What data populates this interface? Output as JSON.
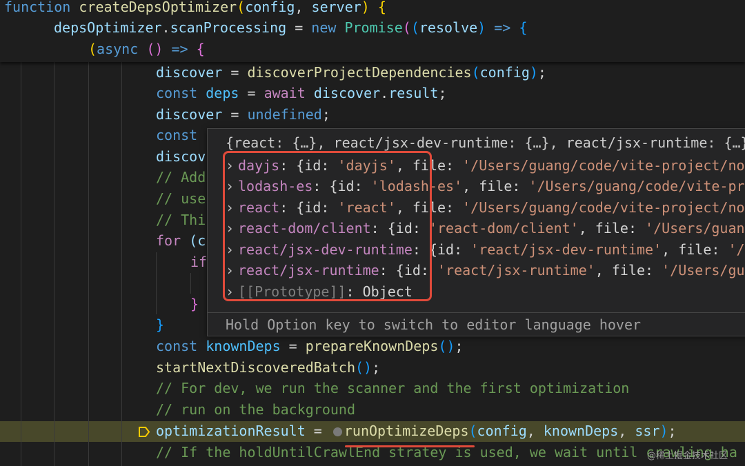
{
  "code": {
    "line1": {
      "kw": "function",
      "fn": "createDepsOptimizer",
      "p1": "(",
      "a1": "config",
      "c1": ", ",
      "a2": "server",
      "p2": ")",
      " b": " {"
    },
    "line2": {
      "obj": "depsOptimizer",
      "dot": ".",
      "prop": "scanProcessing",
      "eq": " = ",
      "kw": "new",
      "cls": "Promise",
      "p1": "(",
      "p2": "(",
      "arg": "resolve",
      "p3": ")",
      "arrow": " => ",
      "b": "{"
    },
    "line3": {
      "p1": "(",
      "kw": "async",
      "sp": " ",
      "p2": "(",
      "p3": ")",
      "arrow": " => ",
      "b": "{"
    },
    "line4": {
      "v": "discover",
      "eq": " = ",
      "fn": "discoverProjectDependencies",
      "p1": "(",
      "a": "config",
      "p2": ")",
      "s": ";"
    },
    "line5": {
      "kw": "const",
      "v": "deps",
      "eq": " = ",
      "ctl": "await",
      "obj": "discover",
      "dot": ".",
      "prop": "result",
      "s": ";"
    },
    "line6": {
      "v": "discover",
      "eq": " = ",
      "kw": "undefined",
      "s": ";"
    },
    "line7": {
      "kw": "const"
    },
    "line8": {
      "v": "discov"
    },
    "line9": {
      "c": "// Add"
    },
    "line10": {
      "c": "// use"
    },
    "line11": {
      "c": "// Thi"
    },
    "line12": {
      "kw": "for",
      "p": " (c"
    },
    "line13": {
      "kw": "if"
    },
    "line15": {
      "b": "}"
    },
    "line16": {
      "b": "}"
    },
    "line17": {
      "kw": "const",
      "v": "knownDeps",
      "eq": " = ",
      "fn": "prepareKnownDeps",
      "p": "()",
      "s": ";"
    },
    "line18": {
      "fn": "startNextDiscoveredBatch",
      "p": "()",
      "s": ";"
    },
    "line19": {
      "c": "// For dev, we run the scanner and the first optimization"
    },
    "line20": {
      "c": "// run on the background"
    },
    "line21": {
      "v": "optimizationResult",
      "eq": " = ",
      "fn": "runOptimizeDeps",
      "p1": "(",
      "a1": "config",
      "c1": ", ",
      "a2": "knownDeps",
      "c2": ", ",
      "a3": "ssr",
      "p2": ")",
      "s": ";"
    },
    "line22": {
      "c": "// If the holdUntilCrawlEnd stratey is used, we wait until crawling ha"
    }
  },
  "hover": {
    "header": "{react: {…}, react/jsx-dev-runtime: {…}, react/jsx-runtime: {…}, da",
    "rows": [
      {
        "key": "dayjs",
        "open": ": {id: ",
        "id": "'dayjs'",
        "mid": ", file: ",
        "file": "'/Users/guang/code/vite-project/node_m"
      },
      {
        "key": "lodash-es",
        "open": ": {id: ",
        "id": "'lodash-es'",
        "mid": ", file: ",
        "file": "'/Users/guang/code/vite-projec"
      },
      {
        "key": "react",
        "open": ": {id: ",
        "id": "'react'",
        "mid": ", file: ",
        "file": "'/Users/guang/code/vite-project/node_m"
      },
      {
        "key": "react-dom/client",
        "open": ": {id: ",
        "id": "'react-dom/client'",
        "mid": ", file: ",
        "file": "'/Users/guang/co"
      },
      {
        "key": "react/jsx-dev-runtime",
        "open": ": {id: ",
        "id": "'react/jsx-dev-runtime'",
        "mid": ", file: ",
        "file": "'/User"
      },
      {
        "key": "react/jsx-runtime",
        "open": ": {id: ",
        "id": "'react/jsx-runtime'",
        "mid": ", file: ",
        "file": "'/Users/guang/"
      }
    ],
    "proto_key": "[[Prototype]]",
    "proto_val": ": Object",
    "footer": "Hold Option key to switch to editor language hover",
    "chevron": "›"
  },
  "watermark": "@稀土掘金技术社区",
  "colors": {
    "highlight_box": "#e04a3a",
    "debug_line": "#48482a",
    "breakpoint": "#ffcc00"
  }
}
